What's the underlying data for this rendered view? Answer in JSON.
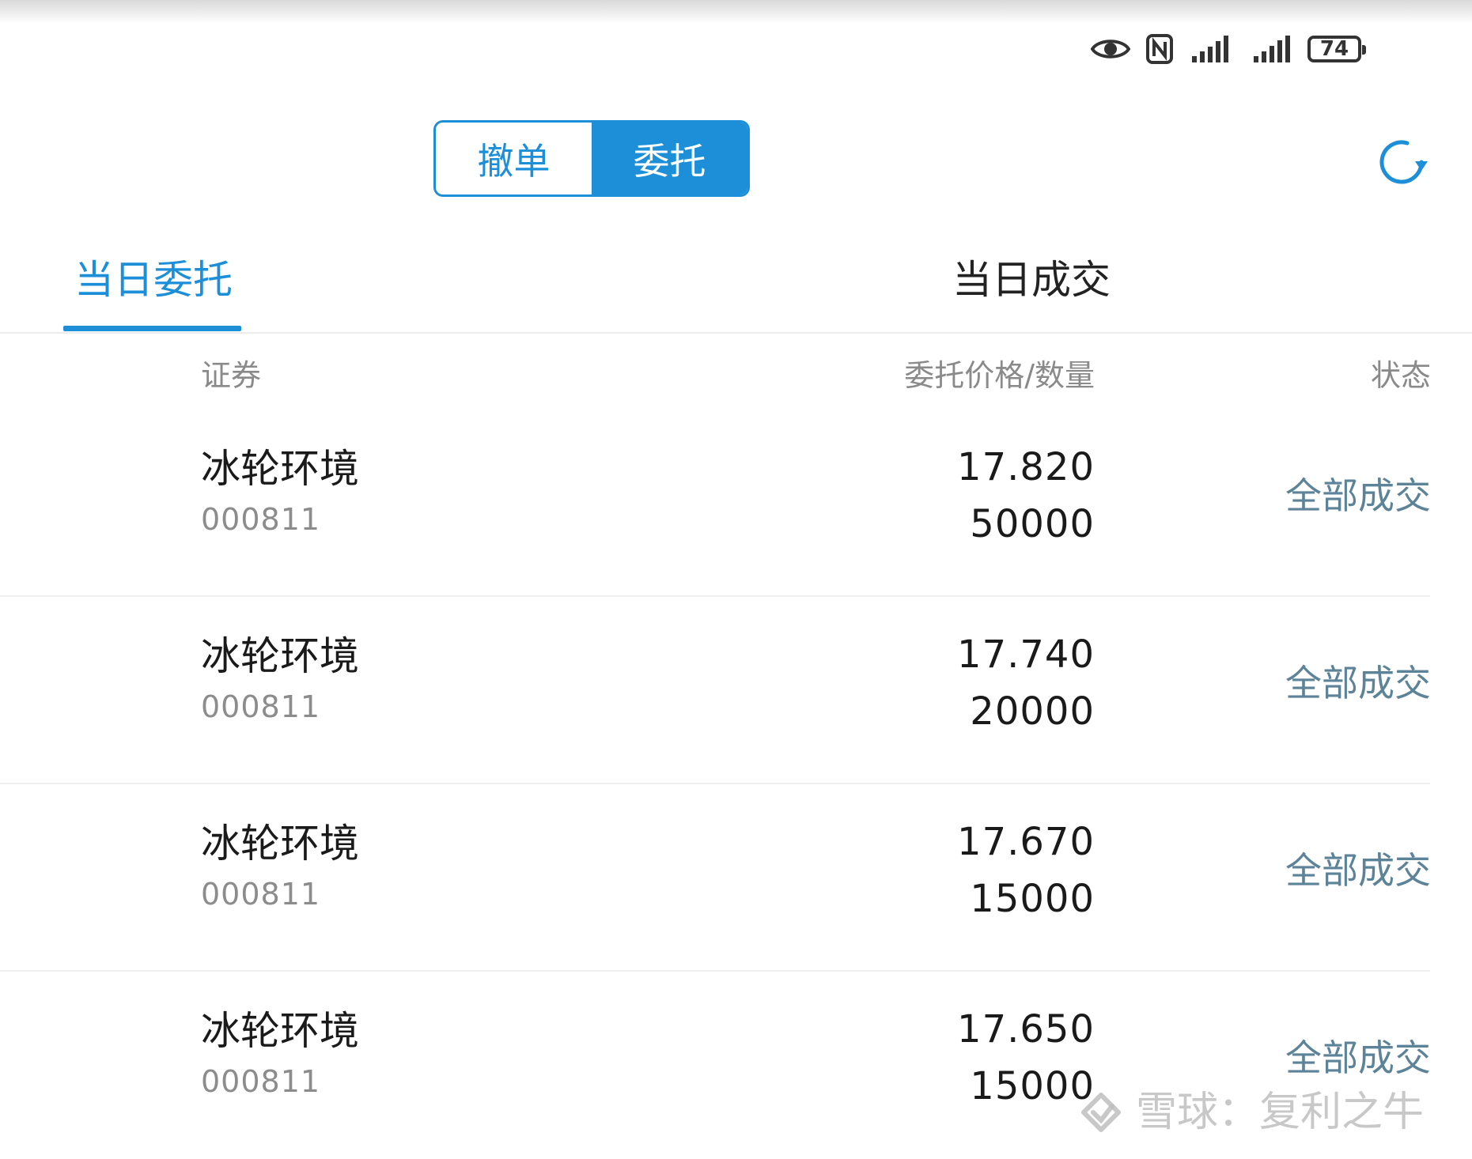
{
  "status_bar": {
    "icons": [
      "eye-icon",
      "nfc-icon",
      "signal-icon",
      "signal-icon"
    ],
    "battery_level": "74"
  },
  "segmented": {
    "cancel_label": "撤单",
    "order_label": "委托",
    "active": "委托"
  },
  "tabs": {
    "orders_today": "当日委托",
    "trades_today": "当日成交",
    "active": "当日委托"
  },
  "columns": {
    "security": "证券",
    "price_qty": "委托价格/数量",
    "status": "状态"
  },
  "rows": [
    {
      "name": "冰轮环境",
      "code": "000811",
      "price": "17.820",
      "quantity": "50000",
      "status": "全部成交"
    },
    {
      "name": "冰轮环境",
      "code": "000811",
      "price": "17.740",
      "quantity": "20000",
      "status": "全部成交"
    },
    {
      "name": "冰轮环境",
      "code": "000811",
      "price": "17.670",
      "quantity": "15000",
      "status": "全部成交"
    },
    {
      "name": "冰轮环境",
      "code": "000811",
      "price": "17.650",
      "quantity": "15000",
      "status": "全部成交"
    }
  ],
  "watermark": {
    "text": "雪球：复利之牛"
  },
  "colors": {
    "accent": "#1d8fd9",
    "status_text": "#5d8398"
  }
}
